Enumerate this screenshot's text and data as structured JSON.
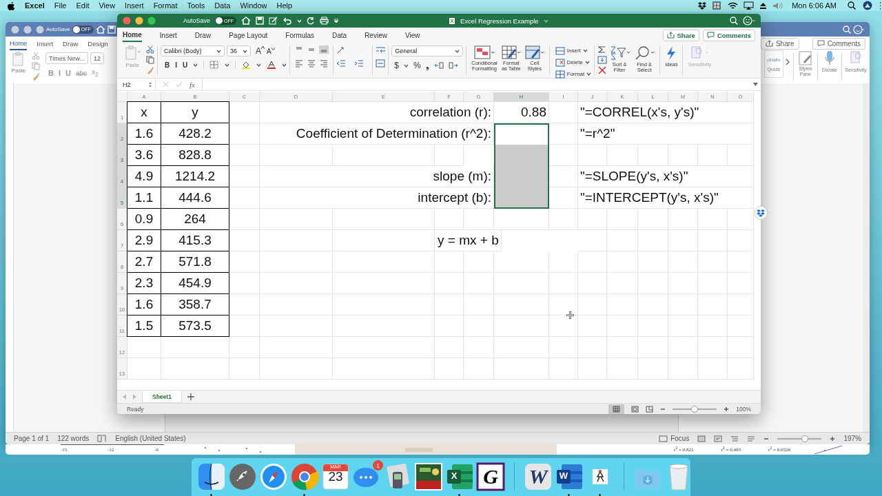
{
  "menubar": {
    "app": "Excel",
    "menus": [
      "File",
      "Edit",
      "View",
      "Insert",
      "Format",
      "Tools",
      "Data",
      "Window",
      "Help"
    ],
    "clock": "Mon 6:06 AM"
  },
  "word": {
    "autosave": {
      "label": "AutoSave",
      "on": false,
      "state_text": "OFF"
    },
    "tabs": [
      {
        "label": "Home",
        "selected": true
      },
      {
        "label": "Insert",
        "selected": false
      },
      {
        "label": "Draw",
        "selected": false
      },
      {
        "label": "Design",
        "selected": false
      }
    ],
    "share": "Share",
    "comments": "Comments",
    "paste": "Paste",
    "font": "Times New...",
    "font_size": "12",
    "format_buttons": [
      "B",
      "I",
      "U"
    ],
    "strike": "abc",
    "subscript": "x$_{2}$",
    "style_preview": "cDdEe",
    "style_name": "Quote",
    "styles_pane": "Styles Pane",
    "dictate": "Dictate",
    "sensitivity": "Sensitivity",
    "status": {
      "page": "Page 1 of 1",
      "words": "122 words",
      "language": "English (United States)",
      "focus": "Focus",
      "zoom_slider": {
        "level": 0.62
      },
      "zoom": "197%"
    }
  },
  "behind": {
    "axis_ticks": [
      "-15",
      "-12",
      "-9"
    ],
    "r_squared": [
      "r$^{2}$ = 0.821",
      "r$^{2}$ = 0.493",
      "r$^{2}$ = 0.0526"
    ]
  },
  "excel": {
    "title": "Excel Regression Example",
    "autosave": {
      "label": "AutoSave",
      "on": false,
      "state_text": "OFF"
    },
    "tabs": [
      {
        "label": "Home",
        "selected": true
      },
      {
        "label": "Insert",
        "selected": false
      },
      {
        "label": "Draw",
        "selected": false
      },
      {
        "label": "Page Layout",
        "selected": false
      },
      {
        "label": "Formulas",
        "selected": false
      },
      {
        "label": "Data",
        "selected": false
      },
      {
        "label": "Review",
        "selected": false
      },
      {
        "label": "View",
        "selected": false
      }
    ],
    "share": "Share",
    "comments": "Comments",
    "ribbon": {
      "paste": "Paste",
      "font": "Calibri (Body)",
      "font_size": "36",
      "grow": "A",
      "shrink": "A",
      "format_buttons": [
        "B",
        "I",
        "U"
      ],
      "number_format": "General",
      "currency": "$",
      "percent": "%",
      "comma": "❟",
      "conditional": "Conditional Formatting",
      "format_table": "Format as Table",
      "cell_styles": "Cell Styles",
      "insert": "Insert",
      "delete": "Delete",
      "format": "Format",
      "sort": "Sort & Filter",
      "find": "Find & Select",
      "ideas": "Ideas",
      "sensitivity": "Sensitivity"
    },
    "name_box": "H2",
    "fx": "fx",
    "columns": [
      {
        "label": "A",
        "selected": false
      },
      {
        "label": "B",
        "selected": false
      },
      {
        "label": "C",
        "selected": false
      },
      {
        "label": "D",
        "selected": false
      },
      {
        "label": "E",
        "selected": false
      },
      {
        "label": "F",
        "selected": false
      },
      {
        "label": "G",
        "selected": false
      },
      {
        "label": "H",
        "selected": true
      },
      {
        "label": "I",
        "selected": false
      },
      {
        "label": "J",
        "selected": false
      },
      {
        "label": "K",
        "selected": false
      },
      {
        "label": "L",
        "selected": false
      },
      {
        "label": "M",
        "selected": false
      },
      {
        "label": "N",
        "selected": false
      },
      {
        "label": "O",
        "selected": false
      }
    ],
    "rows": [
      {
        "number": "1",
        "selected": false,
        "A": "x",
        "B": "y",
        "label": "correlation (r):",
        "H": "0.88",
        "J": "\"=CORREL(x's, y's)\""
      },
      {
        "number": "2",
        "selected": true,
        "active": true,
        "A": "1.6",
        "B": "428.2",
        "label": "Coefficient of Determination (r^2):",
        "J": "\"=r^2\""
      },
      {
        "number": "3",
        "selected": true,
        "A": "3.6",
        "B": "828.8"
      },
      {
        "number": "4",
        "selected": true,
        "A": "4.9",
        "B": "1214.2",
        "label": "slope (m):",
        "J": "\"=SLOPE(y's, x's)\""
      },
      {
        "number": "5",
        "selected": true,
        "A": "1.1",
        "B": "444.6",
        "label": "intercept (b):",
        "J": "\"=INTERCEPT(y's, x's)\""
      },
      {
        "number": "6",
        "selected": false,
        "A": "0.9",
        "B": "264"
      },
      {
        "number": "7",
        "selected": false,
        "A": "2.9",
        "B": "415.3",
        "equation": "y = mx + b"
      },
      {
        "number": "8",
        "selected": false,
        "A": "2.7",
        "B": "571.8"
      },
      {
        "number": "9",
        "selected": false,
        "A": "2.3",
        "B": "454.9"
      },
      {
        "number": "10",
        "selected": false,
        "A": "1.6",
        "B": "358.7"
      },
      {
        "number": "11",
        "selected": false,
        "A": "1.5",
        "B": "573.5"
      },
      {
        "number": "12",
        "selected": false
      },
      {
        "number": "13",
        "selected": false
      }
    ],
    "sheets": [
      {
        "label": "Sheet1",
        "selected": true
      }
    ],
    "status": "Ready",
    "zoom_slider": {
      "level": 0.5
    },
    "zoom": "100%"
  },
  "dock": [
    {
      "kind": "finder",
      "running": true
    },
    {
      "kind": "launchpad",
      "running": false
    },
    {
      "kind": "safari",
      "running": false
    },
    {
      "kind": "chrome",
      "running": true
    },
    {
      "kind": "calendar",
      "month": "MAR",
      "day": "23",
      "running": false
    },
    {
      "kind": "messages",
      "badge": "1",
      "running": false
    },
    {
      "kind": "preview",
      "running": false
    },
    {
      "kind": "cover",
      "running": false
    },
    {
      "kind": "excel",
      "letter": "X",
      "running": true
    },
    {
      "kind": "serif",
      "letter": "G",
      "running": false
    },
    {
      "kind": "separator"
    },
    {
      "kind": "serif_w",
      "letter": "W",
      "running": false
    },
    {
      "kind": "word",
      "letter": "W",
      "running": true
    },
    {
      "kind": "figure",
      "running": true
    },
    {
      "kind": "separator"
    },
    {
      "kind": "downloads",
      "running": false
    },
    {
      "kind": "trash",
      "running": false
    }
  ]
}
